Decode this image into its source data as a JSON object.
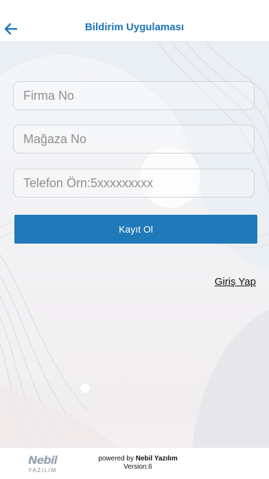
{
  "header": {
    "title": "Bildirim Uygulaması",
    "back_icon": "arrow-left-icon"
  },
  "form": {
    "company_placeholder": "Firma No",
    "store_placeholder": "Mağaza No",
    "phone_placeholder": "Telefon Örn:5xxxxxxxxx",
    "submit_label": "Kayıt Ol"
  },
  "login_link": "Giriş Yap",
  "footer": {
    "logo_word": "Nebil",
    "logo_sub": "YAZILIM",
    "powered_prefix": "powered by",
    "powered_brand": "Nebil Yazılım",
    "version": "Version:6"
  },
  "colors": {
    "accent": "#1d74b8",
    "button": "#2079b8"
  }
}
